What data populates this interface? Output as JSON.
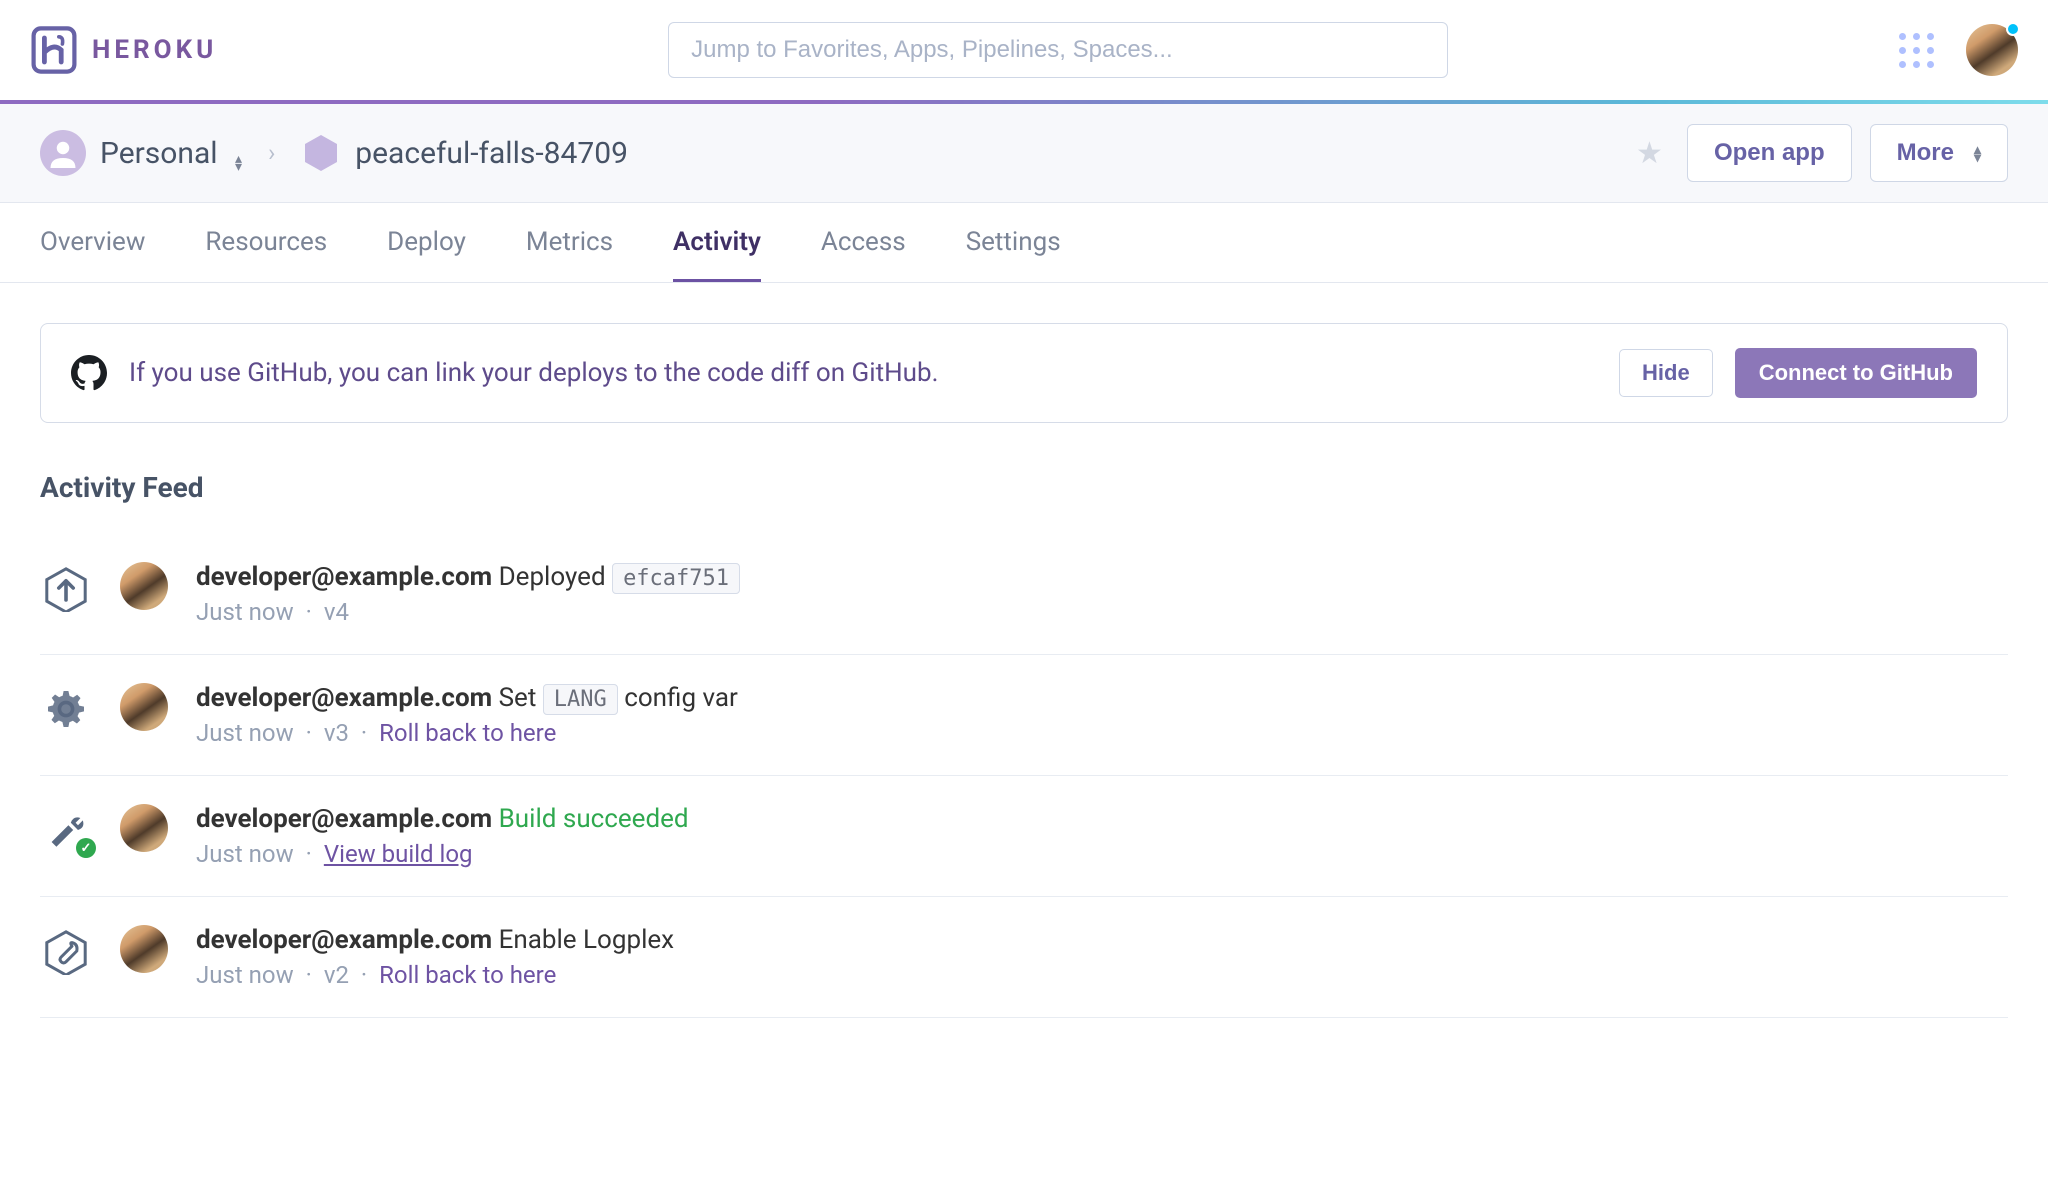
{
  "brand": "HEROKU",
  "search": {
    "placeholder": "Jump to Favorites, Apps, Pipelines, Spaces..."
  },
  "breadcrumb": {
    "scope": "Personal",
    "app": "peaceful-falls-84709",
    "open_btn": "Open app",
    "more_btn": "More"
  },
  "tabs": [
    "Overview",
    "Resources",
    "Deploy",
    "Metrics",
    "Activity",
    "Access",
    "Settings"
  ],
  "active_tab": "Activity",
  "banner": {
    "text": "If you use GitHub, you can link your deploys to the code diff on GitHub.",
    "hide": "Hide",
    "connect": "Connect to GitHub"
  },
  "feed_title": "Activity Feed",
  "activities": [
    {
      "user": "developer@example.com",
      "action": "Deployed",
      "code": "efcaf751",
      "time": "Just now",
      "version": "v4",
      "icon": "deploy"
    },
    {
      "user": "developer@example.com",
      "action_pre": "Set",
      "code": "LANG",
      "action_post": "config var",
      "time": "Just now",
      "version": "v3",
      "rollback": "Roll back to here",
      "icon": "gear"
    },
    {
      "user": "developer@example.com",
      "status": "Build succeeded",
      "time": "Just now",
      "viewlog": "View build log",
      "icon": "build"
    },
    {
      "user": "developer@example.com",
      "action": "Enable Logplex",
      "time": "Just now",
      "version": "v2",
      "rollback": "Roll back to here",
      "icon": "wrench"
    }
  ]
}
